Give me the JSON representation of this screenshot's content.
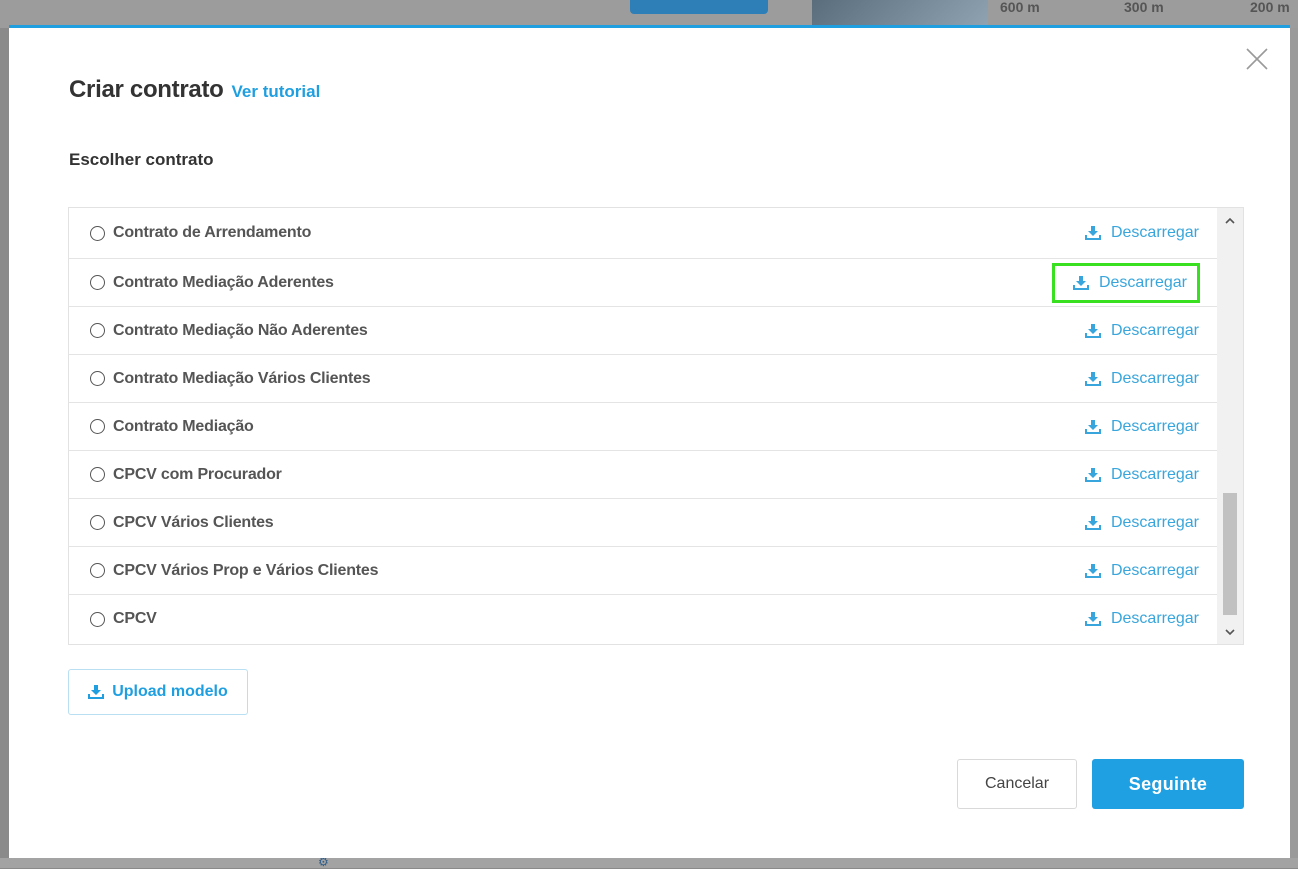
{
  "background": {
    "scale_labels": [
      "600 m",
      "300 m",
      "200 m"
    ]
  },
  "modal": {
    "title": "Criar contrato",
    "tutorial_link": "Ver tutorial",
    "section_title": "Escolher contrato",
    "download_label": "Descarregar",
    "contracts": [
      "Contrato de Arrendamento",
      "Contrato Mediação Aderentes",
      "Contrato Mediação Não Aderentes",
      "Contrato Mediação Vários Clientes",
      "Contrato Mediação",
      "CPCV com Procurador",
      "CPCV Vários Clientes",
      "CPCV Vários Prop e Vários Clientes",
      "CPCV"
    ],
    "upload_label": "Upload modelo",
    "cancel_label": "Cancelar",
    "next_label": "Seguinte"
  },
  "colors": {
    "accent": "#1f9fe0",
    "highlight": "#39e01f"
  }
}
